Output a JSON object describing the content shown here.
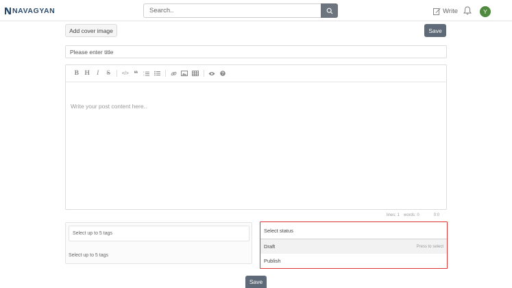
{
  "header": {
    "brand": "NAVAGYAN",
    "search": {
      "placeholder": "Search.."
    },
    "write_label": "Write",
    "avatar_initial": "Y"
  },
  "editor_page": {
    "cover_button": "Add cover image",
    "save_top": "Save",
    "title_placeholder": "Please enter title",
    "toolbar_icons": [
      "bold-icon",
      "heading-icon",
      "italic-icon",
      "strikethrough-icon",
      "code-icon",
      "quote-icon",
      "ordered-list-icon",
      "unordered-list-icon",
      "link-icon",
      "image-icon",
      "table-icon",
      "preview-icon",
      "help-icon"
    ],
    "content_placeholder": "Write your post content here..",
    "status_bar": {
      "lines": "lines: 1",
      "words": "words: 0",
      "cursor": "0:0"
    },
    "tags": {
      "input_placeholder": "Select up to 5 tags",
      "hint": "Select up to 5 tags"
    },
    "status_select": {
      "placeholder": "Select status",
      "options": [
        {
          "label": "Draft",
          "hint": "Press to select"
        },
        {
          "label": "Publish",
          "hint": ""
        }
      ]
    },
    "save_bottom": "Save"
  },
  "colors": {
    "accent_button": "#5e6a77",
    "highlight_border": "#dd3333",
    "avatar": "#4f8a3f"
  }
}
